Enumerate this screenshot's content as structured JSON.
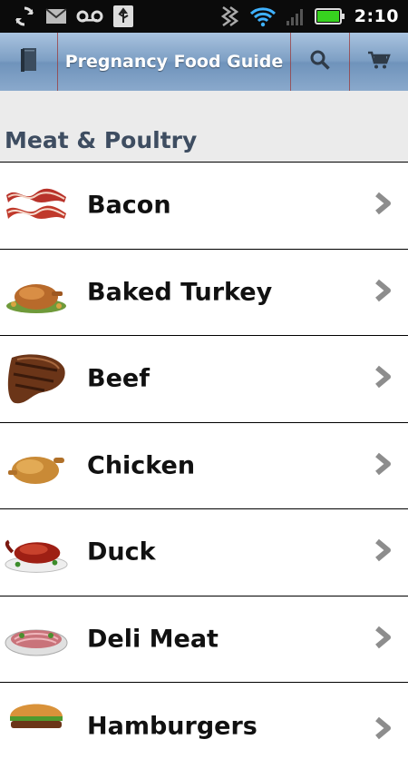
{
  "status_bar": {
    "time": "2:10",
    "icons": [
      "sync-icon",
      "gmail-icon",
      "voicemail-icon",
      "usb-icon",
      "wireless-icon",
      "wifi-icon",
      "signal-icon",
      "battery-icon"
    ]
  },
  "toolbar": {
    "title": "Pregnancy Food Guide",
    "icons": [
      "book-icon",
      "search-icon",
      "cart-icon"
    ]
  },
  "section": {
    "title": "Meat & Poultry"
  },
  "items": [
    {
      "label": "Bacon"
    },
    {
      "label": "Baked Turkey"
    },
    {
      "label": "Beef"
    },
    {
      "label": "Chicken"
    },
    {
      "label": "Duck"
    },
    {
      "label": "Deli Meat"
    },
    {
      "label": "Hamburgers"
    }
  ],
  "colors": {
    "toolbar": "#7d9fc4",
    "section_bg": "#ebebeb",
    "section_text": "#3e4d61",
    "separator": "#9a3a3a"
  }
}
